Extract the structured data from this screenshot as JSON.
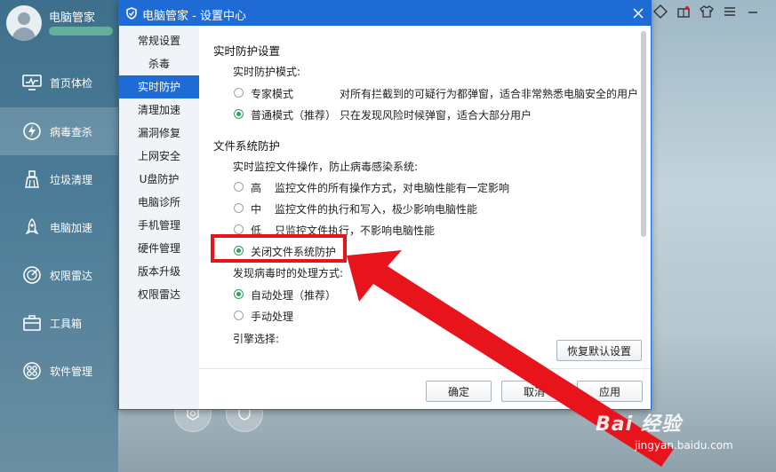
{
  "app": {
    "name": "电脑管家"
  },
  "main_nav": [
    {
      "label": "首页体检",
      "icon": "monitor-icon"
    },
    {
      "label": "病毒查杀",
      "icon": "lightning-shield-icon"
    },
    {
      "label": "垃圾清理",
      "icon": "broom-icon"
    },
    {
      "label": "电脑加速",
      "icon": "rocket-icon"
    },
    {
      "label": "权限雷达",
      "icon": "radar-icon"
    },
    {
      "label": "工具箱",
      "icon": "toolbox-icon"
    },
    {
      "label": "软件管理",
      "icon": "apps-icon"
    }
  ],
  "main_nav_active_index": 1,
  "dialog": {
    "title": "电脑管家 - 设置中心",
    "nav": [
      "常规设置",
      "杀毒",
      "实时防护",
      "清理加速",
      "漏洞修复",
      "上网安全",
      "U盘防护",
      "电脑诊所",
      "手机管理",
      "硬件管理",
      "版本升级",
      "权限雷达"
    ],
    "nav_active_index": 2,
    "content": {
      "realtime_title": "实时防护设置",
      "realtime_mode_label": "实时防护模式:",
      "modes": [
        {
          "name": "专家模式",
          "desc": "对所有拦截到的可疑行为都弹窗，适合非常熟悉电脑安全的用户",
          "checked": false
        },
        {
          "name": "普通模式（推荐）",
          "desc": "只在发现风险时候弹窗，适合大部分用户",
          "checked": true
        }
      ],
      "fs_title": "文件系统防护",
      "fs_monitor_label": "实时监控文件操作，防止病毒感染系统:",
      "fs_levels": [
        {
          "level": "高",
          "desc": "监控文件的所有操作方式，对电脑性能有一定影响",
          "checked": false
        },
        {
          "level": "中",
          "desc": "监控文件的执行和写入，极少影响电脑性能",
          "checked": false
        },
        {
          "level": "低",
          "desc": "只监控文件执行，不影响电脑性能",
          "checked": false
        }
      ],
      "fs_off": {
        "label": "关闭文件系统防护",
        "checked": true
      },
      "virus_action_label": "发现病毒时的处理方式:",
      "virus_actions": [
        {
          "label": "自动处理（推荐）",
          "checked": true
        },
        {
          "label": "手动处理",
          "checked": false
        }
      ],
      "engine_label": "引擎选择:",
      "restore_default_label": "恢复默认设置"
    },
    "buttons": {
      "ok": "确定",
      "cancel": "取消",
      "apply": "应用"
    }
  },
  "watermark": {
    "brand": "Bai 经验",
    "url": "jingyan.baidu.com"
  },
  "colors": {
    "accent": "#1f6bd6",
    "radio_checked": "#2aa35a",
    "annotation": "#e8141c"
  }
}
